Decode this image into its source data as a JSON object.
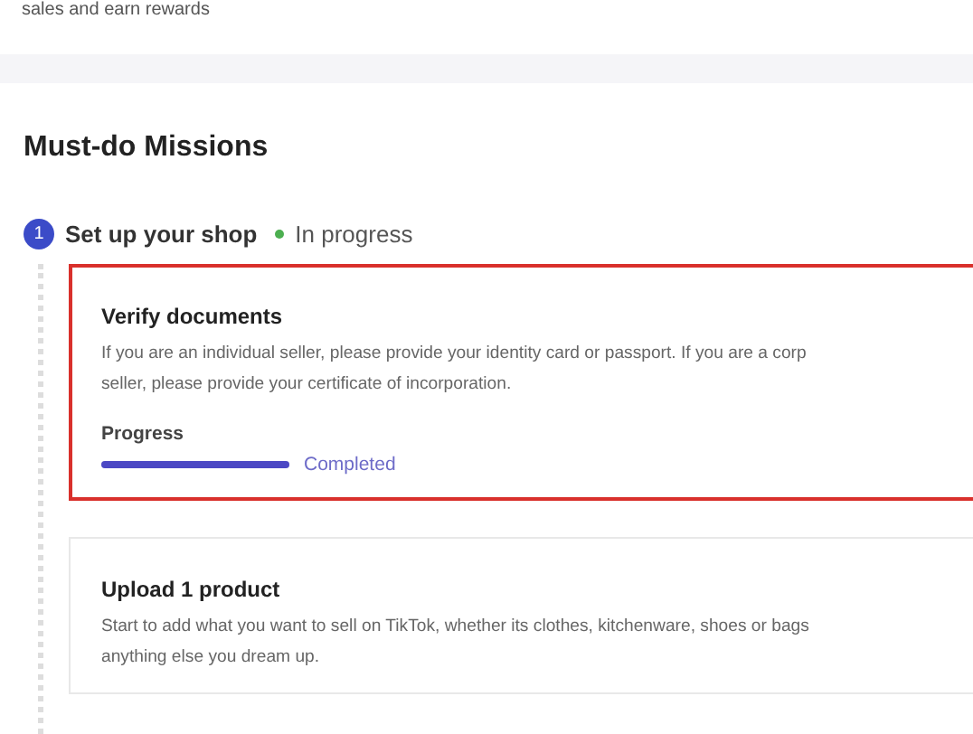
{
  "top_panel": {
    "text": "sales and earn rewards"
  },
  "section": {
    "title": "Must-do Missions",
    "step": {
      "number": "1",
      "title": "Set up your shop",
      "status": "In progress",
      "color": "#4caf50"
    },
    "missions": [
      {
        "title": "Verify documents",
        "highlighted": true,
        "lines": [
          "If you are an individual seller, please provide your identity card or passport. If you are a corp",
          "seller, please provide your certificate of incorporation."
        ],
        "progress": {
          "label": "Progress",
          "level": 1,
          "reading": "Completed"
        }
      },
      {
        "title": "Upload 1 product",
        "highlighted": false,
        "lines": [
          "Start to add what you want to sell on TikTok, whether its clothes, kitchenware, shoes or bags",
          "anything else you dream up."
        ]
      }
    ]
  }
}
